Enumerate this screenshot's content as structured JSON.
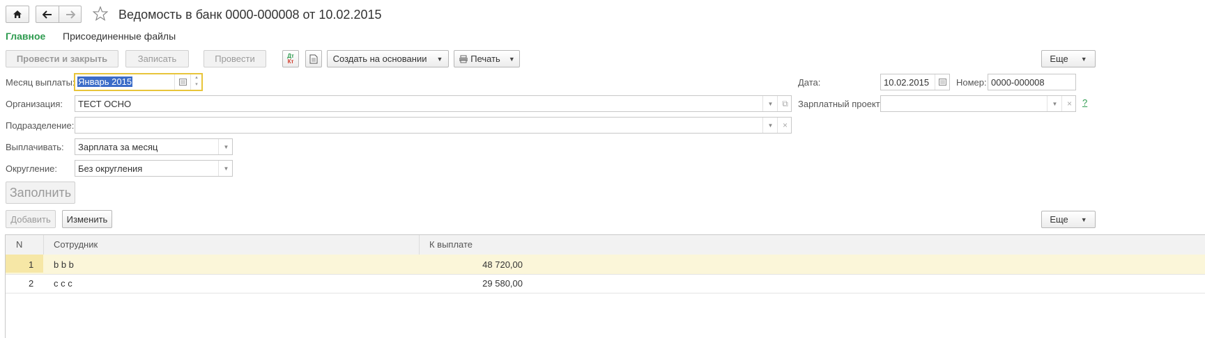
{
  "title": "Ведомость в банк 0000-000008 от 10.02.2015",
  "nav": {
    "tabs": [
      {
        "label": "Главное",
        "active": true
      },
      {
        "label": "Присоединенные файлы",
        "active": false
      }
    ]
  },
  "toolbar": {
    "post_close": "Провести и закрыть",
    "save": "Записать",
    "post": "Провести",
    "create_based": "Создать на основании",
    "print": "Печать",
    "more": "Еще"
  },
  "form": {
    "month_label": "Месяц выплаты:",
    "month_value": "Январь 2015",
    "org_label": "Организация:",
    "org_value": "ТЕСТ ОСНО",
    "dept_label": "Подразделение:",
    "dept_value": "",
    "pay_label": "Выплачивать:",
    "pay_value": "Зарплата за месяц",
    "round_label": "Округление:",
    "round_value": "Без округления",
    "date_label": "Дата:",
    "date_value": "10.02.2015",
    "number_label": "Номер:",
    "number_value": "0000-000008",
    "salary_project_label": "Зарплатный проект:",
    "salary_project_value": "",
    "help": "?",
    "fill_button": "Заполнить"
  },
  "table_toolbar": {
    "add": "Добавить",
    "edit": "Изменить",
    "more": "Еще"
  },
  "table": {
    "columns": [
      "N",
      "Сотрудник",
      "К выплате"
    ],
    "rows": [
      {
        "n": "1",
        "employee": "b b b",
        "amount": "48 720,00"
      },
      {
        "n": "2",
        "employee": "c c c",
        "amount": "29 580,00"
      }
    ]
  },
  "colors": {
    "accent_green": "#2e9b4f",
    "selected_row": "#fbf6d9",
    "focus_border": "#e8c53a",
    "selection_text_bg": "#3b6cc8"
  }
}
